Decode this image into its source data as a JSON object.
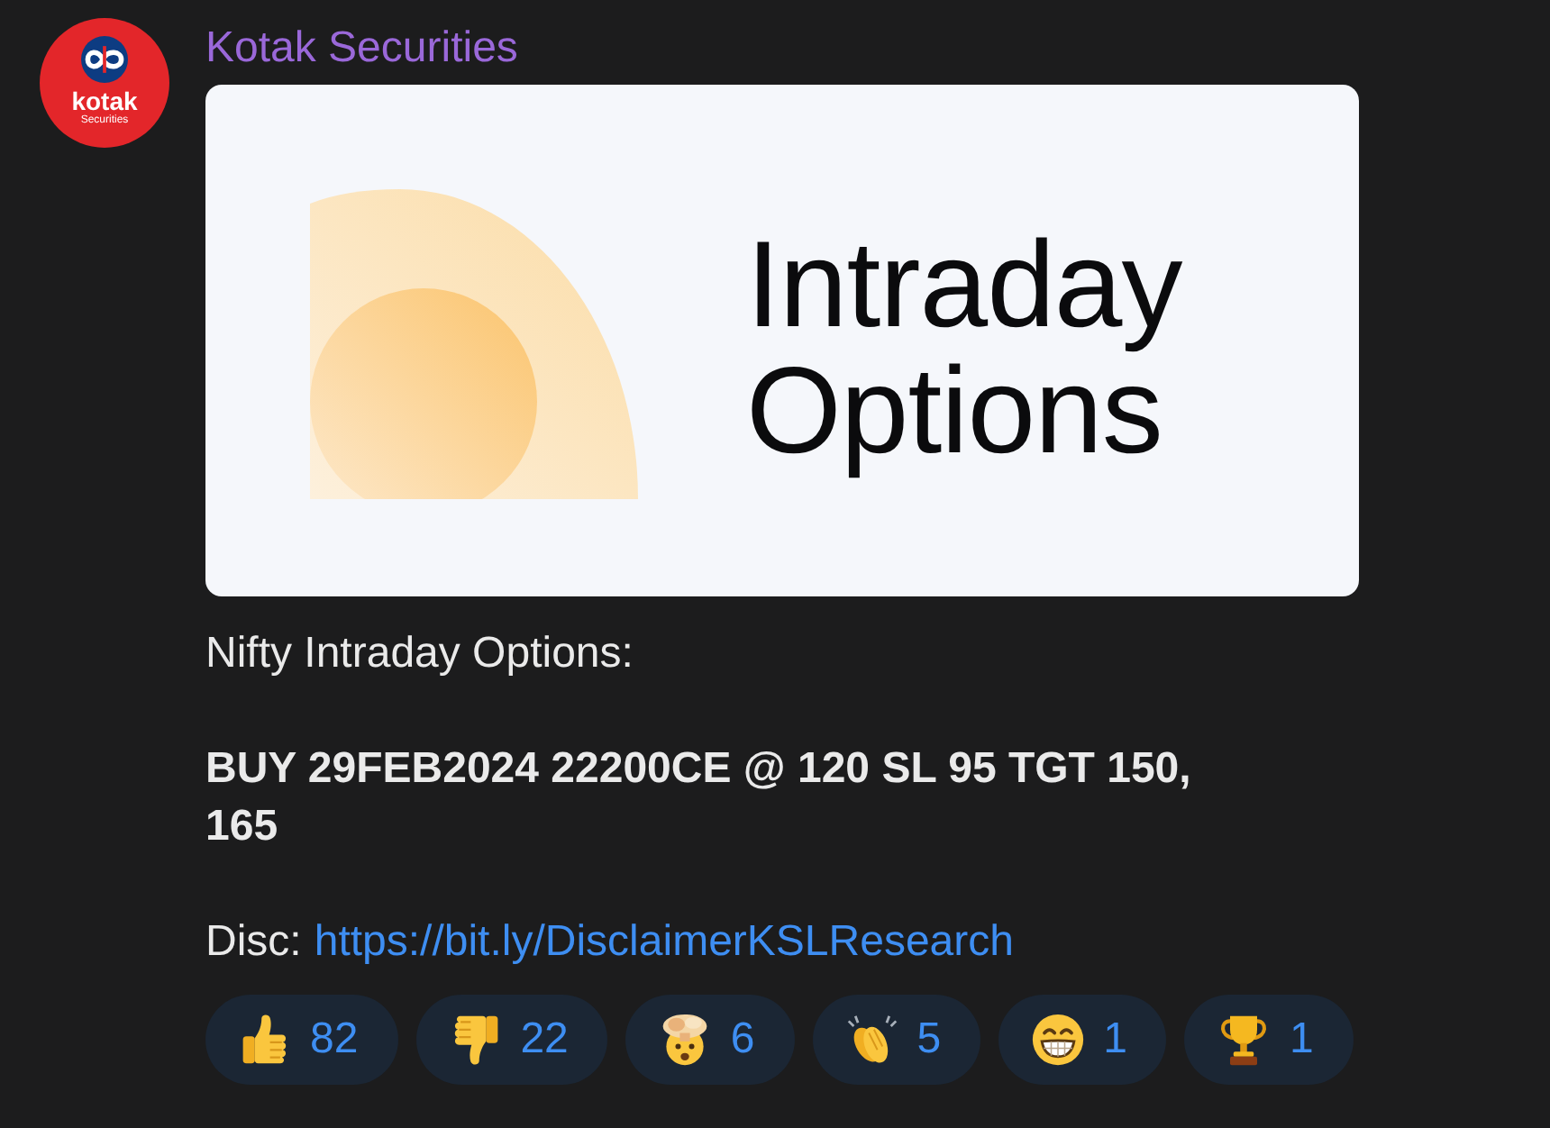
{
  "sender": {
    "name": "Kotak Securities",
    "avatar": {
      "wordmark": "kotak",
      "subtitle": "Securities"
    }
  },
  "banner": {
    "title": "Intraday Options"
  },
  "message": {
    "caption": "Nifty Intraday Options:",
    "signal": "BUY 29FEB2024 22200CE @ 120 SL 95 TGT 150, 165",
    "disclaimer_label": "Disc:",
    "disclaimer_link": "https://bit.ly/DisclaimerKSLResearch"
  },
  "reactions": [
    {
      "kind": "thumbs-up",
      "count": "82",
      "selected": false
    },
    {
      "kind": "thumbs-down",
      "count": "22",
      "selected": false
    },
    {
      "kind": "exploding-head",
      "count": "6",
      "selected": false
    },
    {
      "kind": "clapping",
      "count": "5",
      "selected": false
    },
    {
      "kind": "grin",
      "count": "1",
      "selected": false
    },
    {
      "kind": "trophy",
      "count": "1",
      "selected": false
    }
  ]
}
